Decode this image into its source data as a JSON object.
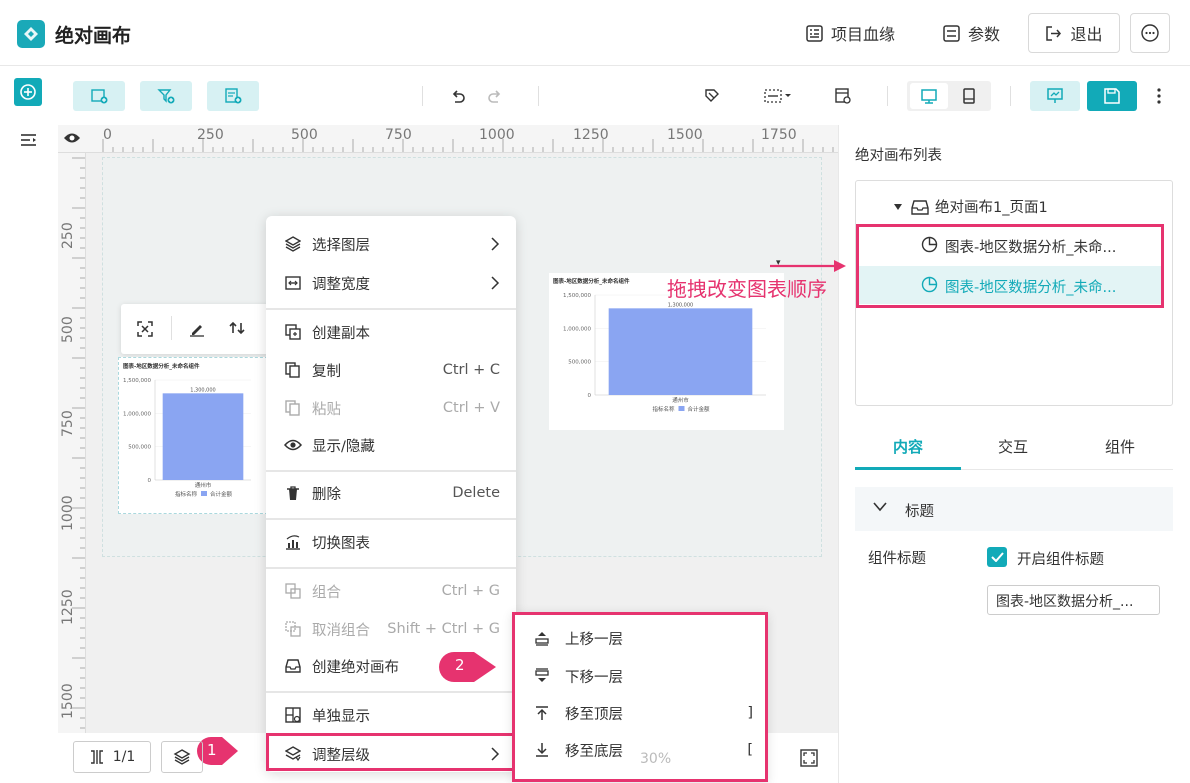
{
  "header": {
    "title": "绝对画布",
    "lineage": "项目血缘",
    "params": "参数",
    "exit": "退出"
  },
  "ruler": {
    "top": [
      "0",
      "250",
      "500",
      "750",
      "1000",
      "1250",
      "1500",
      "1750"
    ],
    "left": [
      "250",
      "500",
      "750",
      "1000",
      "1250",
      "1500"
    ]
  },
  "chart_data": [
    {
      "type": "bar",
      "title": "图表-地区数据分析_未命名组件",
      "categories": [
        "通州市"
      ],
      "values": [
        1300000
      ],
      "ylim": [
        0,
        1500000
      ],
      "yticks": [
        "1,500,000",
        "1,000,000",
        "500,000",
        "0"
      ],
      "data_label": "1,300,000",
      "legend": [
        "指标名称",
        "合计金额"
      ]
    },
    {
      "type": "bar",
      "title": "图表-地区数据分析_未命名组件",
      "categories": [
        "通州市"
      ],
      "values": [
        1300000
      ],
      "ylim": [
        0,
        1500000
      ],
      "yticks": [
        "1,500,000",
        "1,000,000",
        "500,000",
        "0"
      ],
      "data_label": "1,300,000",
      "legend": [
        "指标名称",
        "合计金额"
      ]
    }
  ],
  "context_menu": {
    "items": [
      {
        "label": "选择图层",
        "shortcut": ""
      },
      {
        "label": "调整宽度",
        "shortcut": ""
      },
      {
        "label": "创建副本",
        "shortcut": ""
      },
      {
        "label": "复制",
        "shortcut": "Ctrl + C"
      },
      {
        "label": "粘贴",
        "shortcut": "Ctrl + V"
      },
      {
        "label": "显示/隐藏",
        "shortcut": ""
      },
      {
        "label": "删除",
        "shortcut": "Delete"
      },
      {
        "label": "切换图表",
        "shortcut": ""
      },
      {
        "label": "组合",
        "shortcut": "Ctrl + G"
      },
      {
        "label": "取消组合",
        "shortcut": "Shift + Ctrl + G"
      },
      {
        "label": "创建绝对画布",
        "shortcut": ""
      },
      {
        "label": "单独显示",
        "shortcut": ""
      },
      {
        "label": "调整层级",
        "shortcut": ""
      }
    ]
  },
  "submenu": {
    "items": [
      {
        "label": "上移一层",
        "shortcut": ""
      },
      {
        "label": "下移一层",
        "shortcut": ""
      },
      {
        "label": "移至顶层",
        "shortcut": "]"
      },
      {
        "label": "移至底层",
        "shortcut": "["
      }
    ]
  },
  "badges": {
    "one": "1",
    "two": "2"
  },
  "right_panel": {
    "title": "绝对画布列表",
    "tree": {
      "root": "绝对画布1_页面1",
      "children": [
        "图表-地区数据分析_未命...",
        "图表-地区数据分析_未命..."
      ]
    },
    "annotation": "拖拽改变图表顺序",
    "tabs": [
      "内容",
      "交互",
      "组件"
    ],
    "section": "标题",
    "field_label": "组件标题",
    "checkbox_label": "开启组件标题",
    "title_value": "图表-地区数据分析_..."
  },
  "bottom": {
    "page": "1/1",
    "zoom": "30%"
  },
  "colors": {
    "accent": "#12aab8",
    "highlight": "#e6336f",
    "bar": "#8aa5f2"
  }
}
